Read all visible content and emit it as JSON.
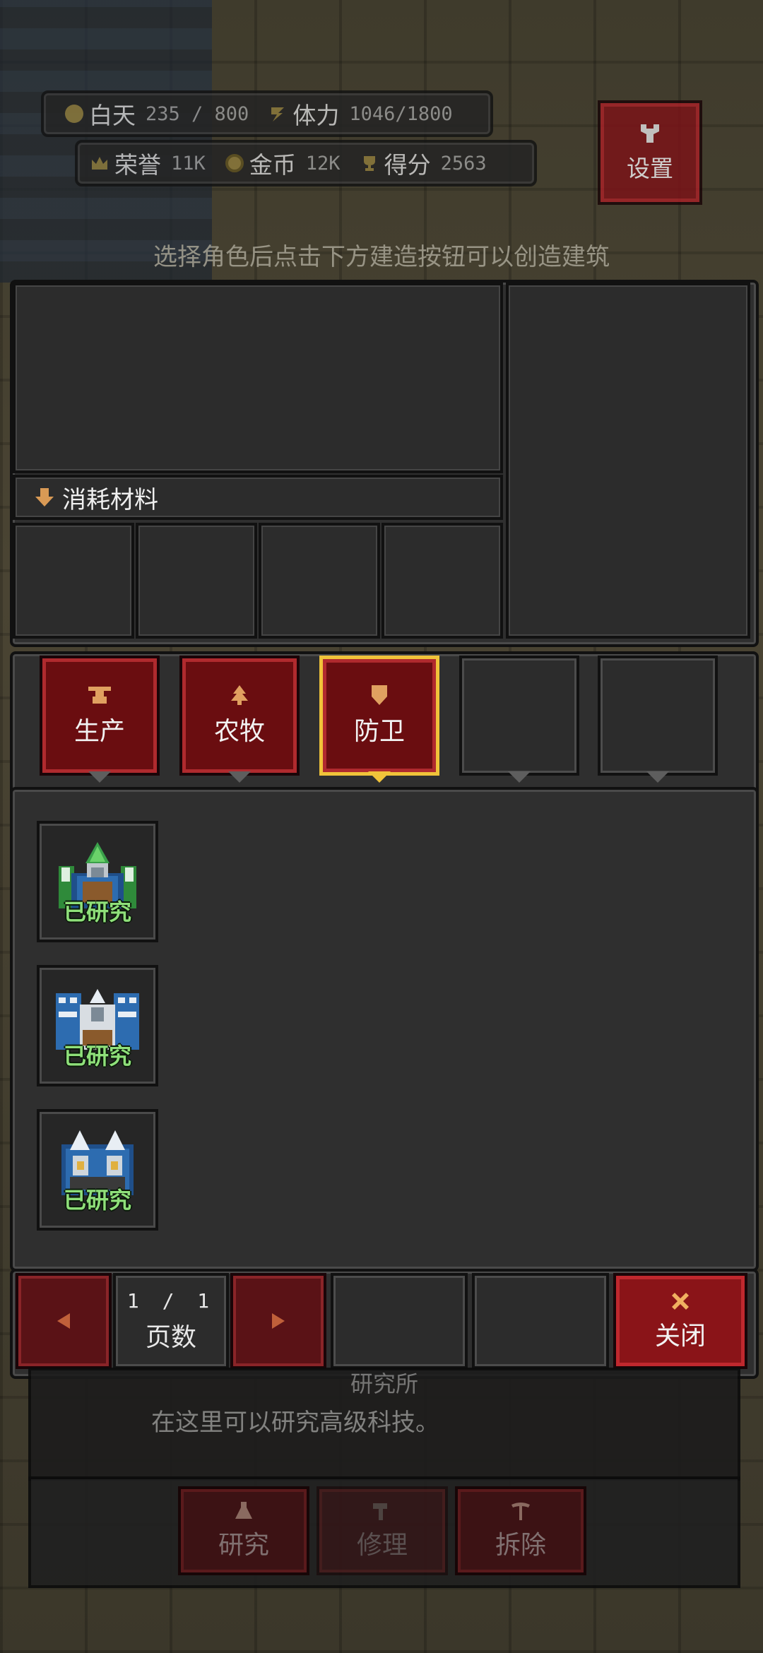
{
  "hud": {
    "day_label": "白天",
    "day_value": "235 / 800",
    "stamina_label": "体力",
    "stamina_value": "1046/1800",
    "honor_label": "荣誉",
    "honor_value": "11K",
    "gold_label": "金币",
    "gold_value": "12K",
    "score_label": "得分",
    "score_value": "2563",
    "settings_label": "设置"
  },
  "hint_text": "选择角色后点击下方建造按钮可以创造建筑",
  "materials": {
    "header_label": "消耗材料"
  },
  "tabs": [
    {
      "label": "生产",
      "icon": "anvil-icon",
      "state": "active"
    },
    {
      "label": "农牧",
      "icon": "tree-icon",
      "state": "active"
    },
    {
      "label": "防卫",
      "icon": "shield-icon",
      "state": "selected"
    },
    {
      "label": "",
      "icon": "",
      "state": "empty"
    },
    {
      "label": "",
      "icon": "",
      "state": "empty"
    }
  ],
  "items": [
    {
      "status": "已研究",
      "icon": "green-tower-icon"
    },
    {
      "status": "已研究",
      "icon": "blue-wall-tower-icon"
    },
    {
      "status": "已研究",
      "icon": "twin-spire-tower-icon"
    }
  ],
  "pagination": {
    "page_current": "1",
    "page_sep": "/",
    "page_total": "1",
    "page_label": "页数"
  },
  "close_label": "关闭",
  "building": {
    "name": "研究所",
    "description": "在这里可以研究高级科技。"
  },
  "actions": {
    "research": "研究",
    "repair": "修理",
    "demolish": "拆除"
  },
  "colors": {
    "selected_tab_border": "#f0c33a",
    "tab_red": "#6a0d10",
    "researched_text": "#8fe07a"
  }
}
